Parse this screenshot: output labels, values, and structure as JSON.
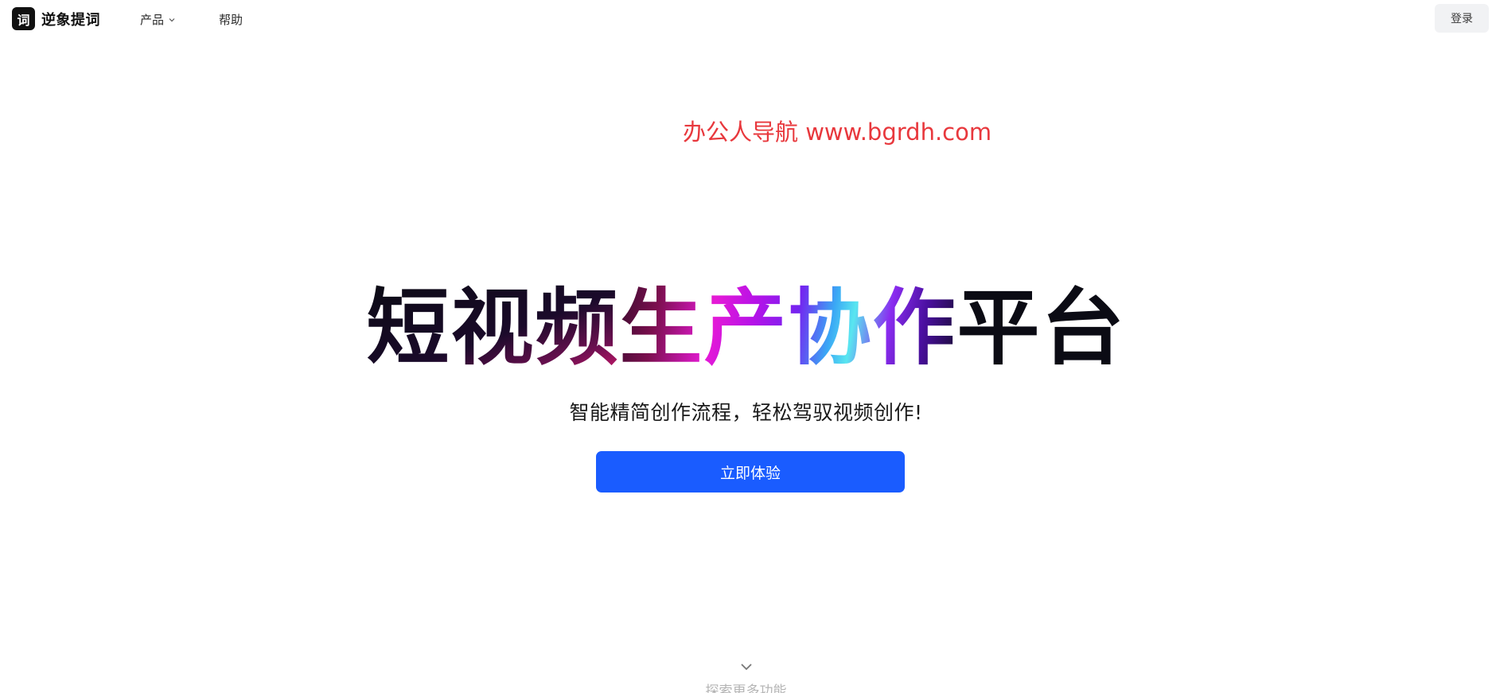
{
  "nav": {
    "logo_mark": "词",
    "brand": "逆象提词",
    "items": [
      {
        "label": "产品",
        "has_dropdown": true
      },
      {
        "label": "帮助",
        "has_dropdown": false
      }
    ],
    "login_label": "登录"
  },
  "watermark": "办公人导航 www.bgrdh.com",
  "hero": {
    "title_part1": "短视频",
    "title_part2": "生产协作",
    "title_part3": "平台",
    "subtitle": "智能精简创作流程，轻松驾驭视频创作!",
    "cta_label": "立即体验"
  },
  "scroll": {
    "icon": "chevron-down-icon",
    "label": "探索更多功能"
  },
  "colors": {
    "accent": "#1a5cff",
    "watermark": "#e8383d",
    "login_bg": "#f1f2f4"
  }
}
